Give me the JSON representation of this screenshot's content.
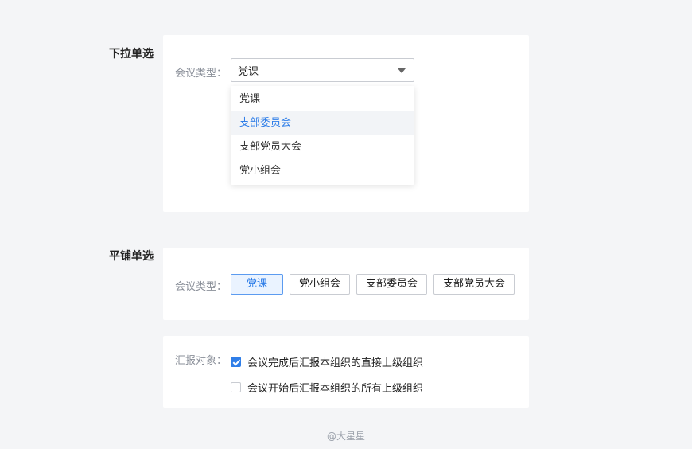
{
  "dropdown_section": {
    "title": "下拉单选",
    "label": "会议类型：",
    "selected": "党课",
    "options": [
      "党课",
      "支部委员会",
      "支部党员大会",
      "党小组会"
    ]
  },
  "tiled_section": {
    "title": "平铺单选",
    "label": "会议类型：",
    "options": [
      "党课",
      "党小组会",
      "支部委员会",
      "支部党员大会"
    ]
  },
  "report_section": {
    "label": "汇报对象：",
    "options": [
      {
        "text": "会议完成后汇报本组织的直接上级组织",
        "checked": true
      },
      {
        "text": "会议开始后汇报本组织的所有上级组织",
        "checked": false
      }
    ]
  },
  "colors": {
    "accent": "#2f7ee8",
    "background": "#f4f5f7"
  },
  "footer": "@大星星"
}
